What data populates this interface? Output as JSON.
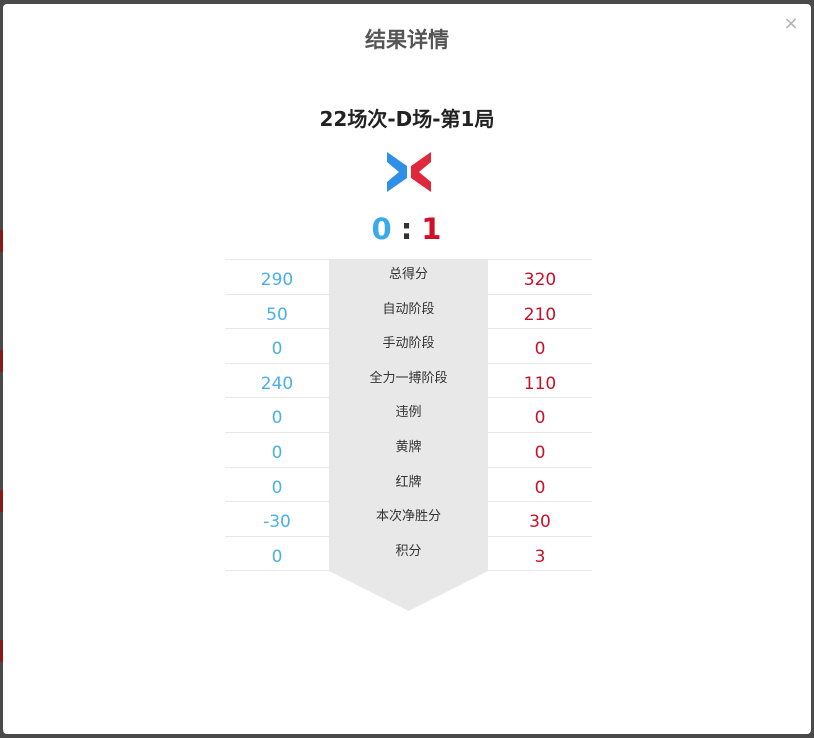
{
  "modal": {
    "title": "结果详情",
    "close_label": "×"
  },
  "match": {
    "title": "22场次-D场-第1局",
    "score_blue": "0",
    "score_separator": ":",
    "score_red": "1",
    "blue_color": "#3aaaea",
    "red_color": "#d0102a"
  },
  "stats": [
    {
      "label": "总得分",
      "blue": "290",
      "red": "320"
    },
    {
      "label": "自动阶段",
      "blue": "50",
      "red": "210"
    },
    {
      "label": "手动阶段",
      "blue": "0",
      "red": "0"
    },
    {
      "label": "全力一搏阶段",
      "blue": "240",
      "red": "110"
    },
    {
      "label": "违例",
      "blue": "0",
      "red": "0"
    },
    {
      "label": "黄牌",
      "blue": "0",
      "red": "0"
    },
    {
      "label": "红牌",
      "blue": "0",
      "red": "0"
    },
    {
      "label": "本次净胜分",
      "blue": "-30",
      "red": "30"
    },
    {
      "label": "积分",
      "blue": "0",
      "red": "3"
    }
  ],
  "icons": {
    "logo": "versus-logo-icon",
    "close": "close-icon"
  }
}
